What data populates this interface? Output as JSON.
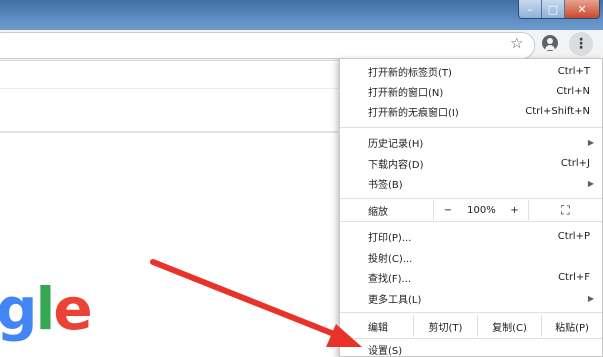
{
  "window": {
    "minimize_glyph": "–",
    "maximize_glyph": "□",
    "close_glyph": "✕"
  },
  "toolbar": {
    "star_glyph": "☆",
    "kebab_glyph": "⋮"
  },
  "logo": {
    "part_g": "g",
    "part_l": "l",
    "part_e": "e"
  },
  "menu": {
    "new_tab": {
      "label": "打开新的标签页(T)",
      "shortcut": "Ctrl+T"
    },
    "new_window": {
      "label": "打开新的窗口(N)",
      "shortcut": "Ctrl+N"
    },
    "new_incognito": {
      "label": "打开新的无痕窗口(I)",
      "shortcut": "Ctrl+Shift+N"
    },
    "history": {
      "label": "历史记录(H)",
      "arrow": "▶"
    },
    "downloads": {
      "label": "下载内容(D)",
      "shortcut": "Ctrl+J"
    },
    "bookmarks": {
      "label": "书签(B)",
      "arrow": "▶"
    },
    "zoom": {
      "label": "缩放",
      "minus": "−",
      "value": "100%",
      "plus": "+",
      "fullscreen": "⛶"
    },
    "print": {
      "label": "打印(P)...",
      "shortcut": "Ctrl+P"
    },
    "cast": {
      "label": "投射(C)..."
    },
    "find": {
      "label": "查找(F)...",
      "shortcut": "Ctrl+F"
    },
    "more_tools": {
      "label": "更多工具(L)",
      "arrow": "▶"
    },
    "edit": {
      "label": "编辑",
      "cut": "剪切(T)",
      "copy": "复制(C)",
      "paste": "粘贴(P)"
    },
    "settings": {
      "label": "设置(S)"
    }
  },
  "annotation": {
    "arrow_color": "#e8332a"
  }
}
